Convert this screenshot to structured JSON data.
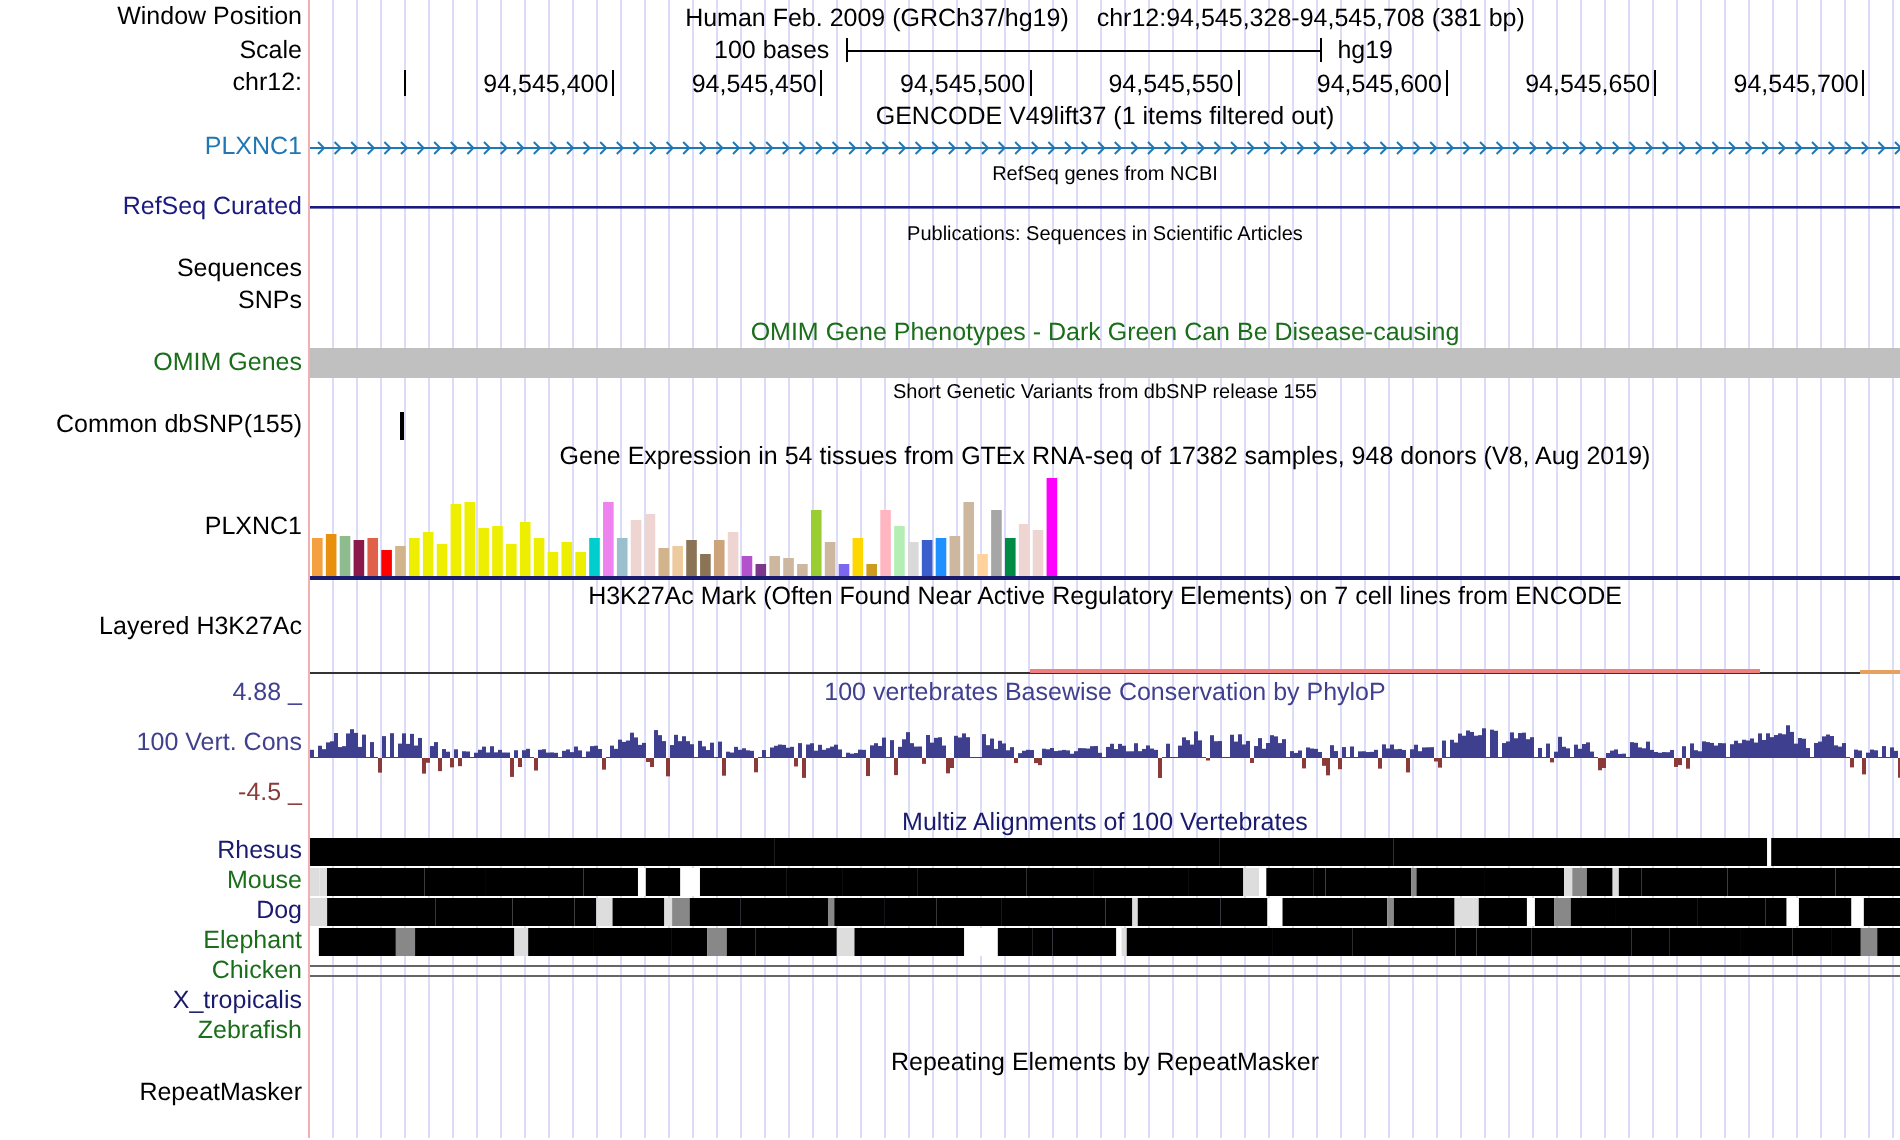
{
  "header": {
    "label": "Window Position",
    "title": "Human Feb. 2009 (GRCh37/hg19)",
    "position": "chr12:94,545,328-94,545,708 (381 bp)"
  },
  "scale": {
    "label": "Scale",
    "length": "100 bases",
    "assembly": "hg19"
  },
  "ruler": {
    "label": "chr12:",
    "ticks": [
      "94,545,400",
      "94,545,450",
      "94,545,500",
      "94,545,550",
      "94,545,600",
      "94,545,650",
      "94,545,700"
    ]
  },
  "tracks": [
    {
      "kind": "gene",
      "title": "GENCODE V49lift37 (1 items filtered out)",
      "labels": [
        "PLXNC1"
      ],
      "color": "#1f78b4"
    },
    {
      "kind": "line",
      "title": "RefSeq genes from NCBI",
      "labels": [
        "RefSeq Curated"
      ],
      "color": "#1a1a80"
    },
    {
      "kind": "empty",
      "title": "Publications: Sequences in Scientific Articles",
      "labels": [
        "Sequences",
        "SNPs"
      ],
      "color": "#000000"
    },
    {
      "kind": "bar",
      "title": "OMIM Gene Phenotypes - Dark Green Can Be Disease-causing",
      "labels": [
        "OMIM Genes"
      ],
      "color": "#1a6e1a"
    },
    {
      "kind": "snp",
      "title": "Short Genetic Variants from dbSNP release 155",
      "labels": [
        "Common dbSNP(155)"
      ],
      "color": "#000000"
    },
    {
      "kind": "expression",
      "title": "Gene Expression in 54 tissues from GTEx RNA-seq of 17382 samples, 948 donors (V8, Aug 2019)",
      "labels": [
        "PLXNC1"
      ],
      "color": "#000000"
    },
    {
      "kind": "layered",
      "title": "H3K27Ac Mark (Often Found Near Active Regulatory Elements) on 7 cell lines from ENCODE",
      "labels": [
        "Layered H3K27Ac"
      ],
      "color": "#000000"
    },
    {
      "kind": "wiggle",
      "title": "100 vertebrates Basewise Conservation by PhyloP",
      "labels": [
        "100 Vert. Cons"
      ],
      "color": "#40408f",
      "max": "4.88 _",
      "min": "-4.5 _"
    },
    {
      "kind": "multiz",
      "title": "Multiz Alignments of 100 Vertebrates",
      "color": "#1a1a6e",
      "species": [
        {
          "name": "Rhesus",
          "color": "#1a1a6e",
          "kind": "solid"
        },
        {
          "name": "Mouse",
          "color": "#1a6e1a",
          "kind": "patchy"
        },
        {
          "name": "Dog",
          "color": "#1a1a6e",
          "kind": "patchy"
        },
        {
          "name": "Elephant",
          "color": "#1a6e1a",
          "kind": "patchy"
        },
        {
          "name": "Chicken",
          "color": "#1a6e1a",
          "kind": "lines"
        },
        {
          "name": "X_tropicalis",
          "color": "#1a1a6e",
          "kind": "none"
        },
        {
          "name": "Zebrafish",
          "color": "#1a6e1a",
          "kind": "none"
        }
      ]
    },
    {
      "kind": "empty",
      "title": "Repeating Elements by RepeatMasker",
      "labels": [
        "RepeatMasker"
      ],
      "color": "#000000"
    }
  ]
}
